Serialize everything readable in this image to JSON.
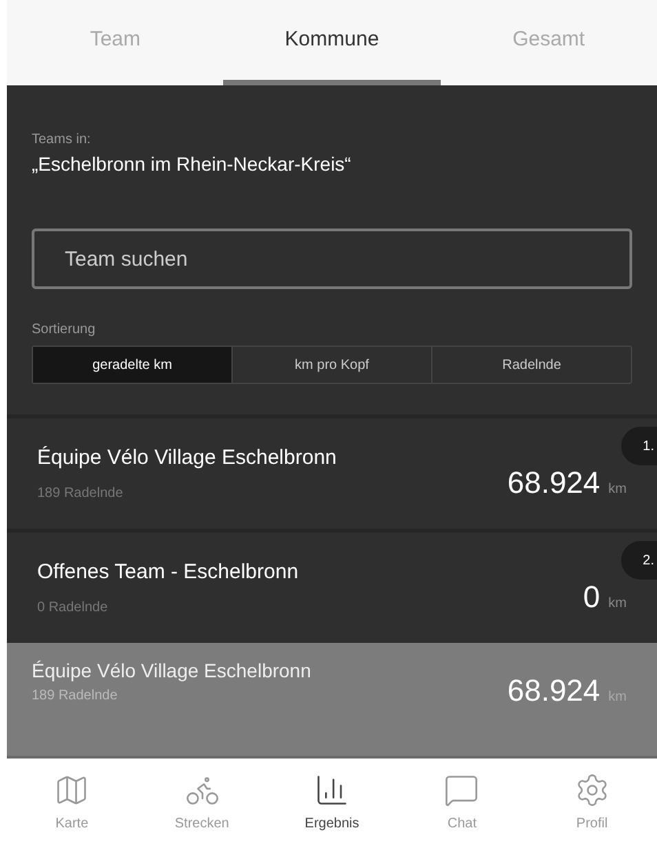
{
  "tabs": [
    {
      "label": "Team",
      "selected": false
    },
    {
      "label": "Kommune",
      "selected": true
    },
    {
      "label": "Gesamt",
      "selected": false
    }
  ],
  "header": {
    "label": "Teams in:",
    "municipality": "„Eschelbronn im Rhein-Neckar-Kreis“"
  },
  "search": {
    "placeholder": "Team suchen"
  },
  "sort": {
    "label": "Sortierung",
    "options": [
      {
        "label": "geradelte km",
        "selected": true
      },
      {
        "label": "km pro Kopf",
        "selected": false
      },
      {
        "label": "Radelnde",
        "selected": false
      }
    ]
  },
  "teams": [
    {
      "rank": "1.",
      "name": "Équipe Vélo Village Eschelbronn",
      "riders": "189 Radelnde",
      "distance": "68.924",
      "unit": "km"
    },
    {
      "rank": "2.",
      "name": "Offenes Team - Eschelbronn",
      "riders": "0 Radelnde",
      "distance": "0",
      "unit": "km"
    }
  ],
  "own_team": {
    "name": "Équipe Vélo Village Eschelbronn",
    "riders": "189 Radelnde",
    "distance": "68.924",
    "unit": "km"
  },
  "nav": [
    {
      "kind": "map",
      "label": "Karte",
      "selected": false
    },
    {
      "kind": "bike",
      "label": "Strecken",
      "selected": false
    },
    {
      "kind": "chart",
      "label": "Ergebnis",
      "selected": true
    },
    {
      "kind": "chat",
      "label": "Chat",
      "selected": false
    },
    {
      "kind": "settings",
      "label": "Profil",
      "selected": false
    }
  ]
}
